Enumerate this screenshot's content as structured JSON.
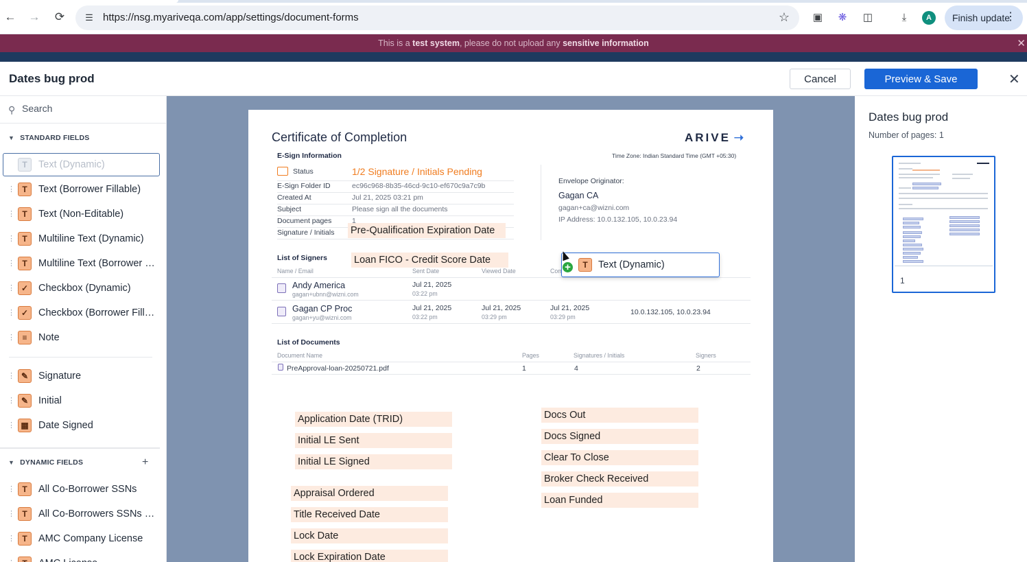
{
  "browser": {
    "url": "https://nsg.myariveqa.com/app/settings/document-forms",
    "profile_initial": "A",
    "finish_update": "Finish update"
  },
  "banner": {
    "prefix": "This is a ",
    "strong1": "test system",
    "middle": ", please do not upload any ",
    "strong2": "sensitive information"
  },
  "header": {
    "title": "Dates bug prod",
    "cancel": "Cancel",
    "save": "Preview & Save"
  },
  "sidebar": {
    "search_placeholder": "Search",
    "standard_heading": "STANDARD FIELDS",
    "dynamic_heading": "DYNAMIC FIELDS",
    "ghost_label": "Text (Dynamic)",
    "standard_fields": [
      {
        "label": "Text (Borrower Fillable)",
        "icon": "text-fillable-icon"
      },
      {
        "label": "Text (Non-Editable)",
        "icon": "text-noneditable-icon"
      },
      {
        "label": "Multiline Text (Dynamic)",
        "icon": "multiline-icon"
      },
      {
        "label": "Multiline Text (Borrower Fillable)",
        "icon": "multiline-icon"
      },
      {
        "label": "Checkbox (Dynamic)",
        "icon": "checkbox-icon"
      },
      {
        "label": "Checkbox (Borrower Fillable)",
        "icon": "checkbox-icon"
      },
      {
        "label": "Note",
        "icon": "note-icon"
      }
    ],
    "signature_fields": [
      {
        "label": "Signature",
        "icon": "pen-icon"
      },
      {
        "label": "Initial",
        "icon": "pen-icon"
      },
      {
        "label": "Date Signed",
        "icon": "calendar-icon"
      }
    ],
    "dynamic_fields": [
      {
        "label": "All Co-Borrower SSNs",
        "icon": "text-icon"
      },
      {
        "label": "All Co-Borrowers SSNs (Masked)",
        "icon": "text-icon"
      },
      {
        "label": "AMC Company License",
        "icon": "text-icon"
      },
      {
        "label": "AMC License",
        "icon": "text-icon"
      }
    ]
  },
  "document": {
    "title": "Certificate of Completion",
    "logo": "ARIVE",
    "esign_heading": "E-Sign Information",
    "timezone": "Time Zone: Indian Standard Time (GMT +05:30)",
    "status_label": "Status",
    "status_value": "1/2 Signature / Initials Pending",
    "info_rows": [
      {
        "label": "E-Sign Folder ID",
        "value": "ec96c968-8b35-46cd-9c10-ef670c9a7c9b"
      },
      {
        "label": "Created At",
        "value": "Jul 21, 2025 03:21 pm"
      },
      {
        "label": "Subject",
        "value": "Please sign all the documents"
      },
      {
        "label": "Document pages",
        "value": "1"
      },
      {
        "label": "Signature / Initials",
        "value": "4"
      }
    ],
    "originator_heading": "Envelope Originator:",
    "originator_name": "Gagan CA",
    "originator_email": "gagan+ca@wizni.com",
    "originator_ip": "IP Address: 10.0.132.105, 10.0.23.94",
    "signers_heading": "List of Signers",
    "signer_cols": [
      "Name / Email",
      "Sent Date",
      "Viewed Date",
      "Completed Date"
    ],
    "signers": [
      {
        "name": "Andy America",
        "email": "gagan+ubnn@wizni.com",
        "sent": "Jul 21, 2025",
        "sent_time": "03:22 pm",
        "viewed": "",
        "viewed_time": "",
        "completed": "",
        "completed_time": "",
        "ip": ""
      },
      {
        "name": "Gagan CP Proc",
        "email": "gagan+yu@wizni.com",
        "sent": "Jul 21, 2025",
        "sent_time": "03:22 pm",
        "viewed": "Jul 21, 2025",
        "viewed_time": "03:29 pm",
        "completed": "Jul 21, 2025",
        "completed_time": "03:29 pm",
        "ip": "10.0.132.105, 10.0.23.94"
      }
    ],
    "docs_heading": "List of Documents",
    "doc_cols": [
      "Document Name",
      "Pages",
      "Signatures / Initials",
      "Signers"
    ],
    "docs": [
      {
        "name": "PreApproval-loan-20250721.pdf",
        "pages": "1",
        "sigs": "4",
        "signers": "2"
      }
    ],
    "placed_top": [
      {
        "label": "Pre-Qualification Expiration Date"
      },
      {
        "label": "Loan FICO - Credit Score Date"
      }
    ],
    "placed_left": [
      {
        "label": "Application Date (TRID)"
      },
      {
        "label": "Initial LE Sent"
      },
      {
        "label": "Initial LE Signed"
      },
      {
        "label": "Appraisal Ordered"
      },
      {
        "label": "Title Received Date"
      },
      {
        "label": "Lock Date"
      },
      {
        "label": "Lock Expiration Date"
      }
    ],
    "placed_right": [
      {
        "label": "Docs Out"
      },
      {
        "label": "Docs Signed"
      },
      {
        "label": "Clear To Close"
      },
      {
        "label": "Broker Check Received"
      },
      {
        "label": "Loan Funded"
      }
    ]
  },
  "drag": {
    "label": "Text (Dynamic)",
    "badge": "+"
  },
  "right_panel": {
    "title": "Dates bug prod",
    "pages": "Number of pages: 1",
    "thumb_page": "1"
  }
}
